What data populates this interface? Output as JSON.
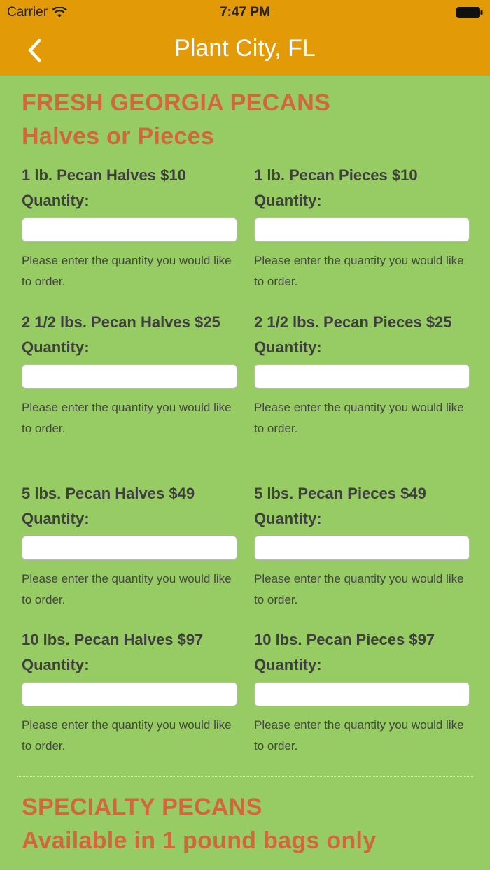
{
  "status_bar": {
    "carrier": "Carrier",
    "time": "7:47 PM"
  },
  "nav": {
    "back_icon": "chevron-left-icon",
    "title": "Plant City, FL"
  },
  "section1": {
    "title": "FRESH GEORGIA PECANS",
    "subtitle": "Halves or Pieces"
  },
  "products": [
    {
      "name": "1 lb. Pecan Halves $10",
      "qty_label": "Quantity:",
      "value": "",
      "help": "Please enter the quantity you would like to order."
    },
    {
      "name": "1 lb. Pecan Pieces $10",
      "qty_label": "Quantity:",
      "value": "",
      "help": "Please enter the quantity you would like to order."
    },
    {
      "name": "2 1/2 lbs. Pecan Halves $25",
      "qty_label": "Quantity:",
      "value": "",
      "help": "Please enter the quantity you would like to order."
    },
    {
      "name": "2 1/2 lbs. Pecan Pieces $25",
      "qty_label": "Quantity:",
      "value": "",
      "help": "Please enter the quantity you would like to order."
    },
    {
      "name": "5 lbs. Pecan Halves $49",
      "qty_label": "Quantity:",
      "value": "",
      "help": "Please enter the quantity you would like to order."
    },
    {
      "name": "5 lbs. Pecan Pieces $49",
      "qty_label": "Quantity:",
      "value": "",
      "help": "Please enter the quantity you would like to order."
    },
    {
      "name": "10 lbs. Pecan Halves $97",
      "qty_label": "Quantity:",
      "value": "",
      "help": "Please enter the quantity you would like to order."
    },
    {
      "name": "10 lbs. Pecan Pieces $97",
      "qty_label": "Quantity:",
      "value": "",
      "help": "Please enter the quantity you would like to order."
    }
  ],
  "section2": {
    "title": "SPECIALTY PECANS",
    "subtitle": "Available in 1 pound bags only"
  },
  "colors": {
    "header": "#e29a06",
    "background": "#97cc64",
    "accent_title": "#d2673e"
  }
}
